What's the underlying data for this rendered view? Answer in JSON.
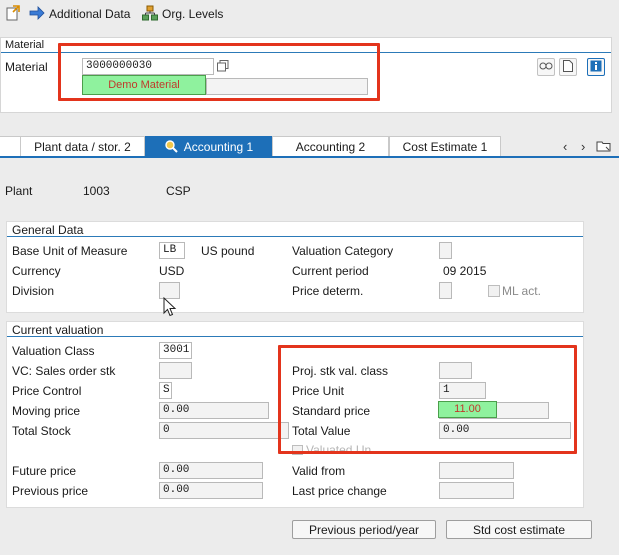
{
  "toolbar": {
    "additional_data": "Additional Data",
    "org_levels": "Org. Levels"
  },
  "material_section": {
    "title": "Material",
    "label": "Material",
    "number": "3000000030",
    "description": "Demo Material"
  },
  "tabs": [
    {
      "label": "Plant data / stor. 2",
      "active": false
    },
    {
      "label": "Accounting 1",
      "active": true
    },
    {
      "label": "Accounting 2",
      "active": false
    },
    {
      "label": "Cost Estimate 1",
      "active": false
    }
  ],
  "plant": {
    "label": "Plant",
    "code": "1003",
    "name": "CSP"
  },
  "general_data": {
    "title": "General Data",
    "base_uom_label": "Base Unit of Measure",
    "base_uom_value": "LB",
    "base_uom_text": "US pound",
    "valuation_category_label": "Valuation Category",
    "valuation_category_value": "",
    "currency_label": "Currency",
    "currency_value": "USD",
    "current_period_label": "Current period",
    "current_period_value": "09 2015",
    "division_label": "Division",
    "division_value": "",
    "price_determ_label": "Price determ.",
    "price_determ_value": "",
    "ml_act_label": "ML act."
  },
  "current_valuation": {
    "title": "Current valuation",
    "valuation_class_label": "Valuation Class",
    "valuation_class_value": "3001",
    "vc_sales_order_label": "VC: Sales order stk",
    "vc_sales_order_value": "",
    "proj_stk_label": "Proj. stk val. class",
    "proj_stk_value": "",
    "price_control_label": "Price Control",
    "price_control_value": "S",
    "price_unit_label": "Price Unit",
    "price_unit_value": "1",
    "moving_price_label": "Moving price",
    "moving_price_value": "0.00",
    "standard_price_label": "Standard price",
    "standard_price_value": "11.00",
    "total_stock_label": "Total Stock",
    "total_stock_value": "0",
    "total_value_label": "Total Value",
    "total_value_value": "0.00",
    "valuated_un_label": "Valuated Un",
    "future_price_label": "Future price",
    "future_price_value": "0.00",
    "valid_from_label": "Valid from",
    "valid_from_value": "",
    "previous_price_label": "Previous price",
    "previous_price_value": "0.00",
    "last_price_change_label": "Last price change",
    "last_price_change_value": ""
  },
  "buttons": {
    "previous_period": "Previous period/year",
    "std_cost_estimate": "Std cost estimate"
  },
  "colors": {
    "accent": "#1d6fb8",
    "highlight_red": "#e3341c",
    "highlight_green": "#8ff29e"
  }
}
